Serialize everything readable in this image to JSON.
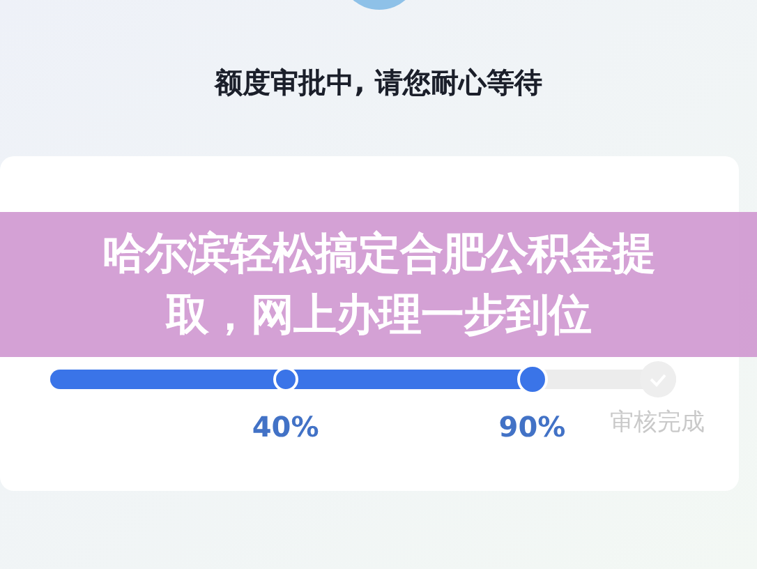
{
  "header": {
    "title": "额度审批中, 请您耐心等待"
  },
  "card": {
    "progress": {
      "level": 0.77,
      "steps": [
        {
          "label": "40%",
          "done": true
        },
        {
          "label": "90%",
          "done": true
        },
        {
          "label": "审核完成",
          "done": false
        }
      ]
    }
  },
  "banner": {
    "text": "哈尔滨轻松搞定合肥公积金提取，网上办理一步到位"
  }
}
